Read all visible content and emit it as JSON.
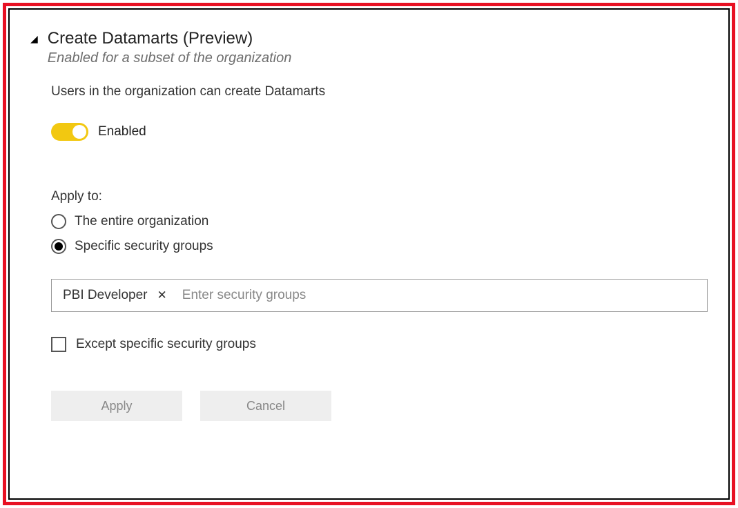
{
  "header": {
    "title": "Create Datamarts (Preview)",
    "subtitle": "Enabled for a subset of the organization"
  },
  "description": "Users in the organization can create Datamarts",
  "toggle": {
    "label": "Enabled",
    "state": "on"
  },
  "applyTo": {
    "label": "Apply to:",
    "options": [
      {
        "label": "The entire organization",
        "selected": false
      },
      {
        "label": "Specific security groups",
        "selected": true
      }
    ]
  },
  "securityGroups": {
    "tags": [
      {
        "label": "PBI Developer"
      }
    ],
    "placeholder": "Enter security groups"
  },
  "except": {
    "label": "Except specific security groups",
    "checked": false
  },
  "buttons": {
    "apply": "Apply",
    "cancel": "Cancel"
  }
}
